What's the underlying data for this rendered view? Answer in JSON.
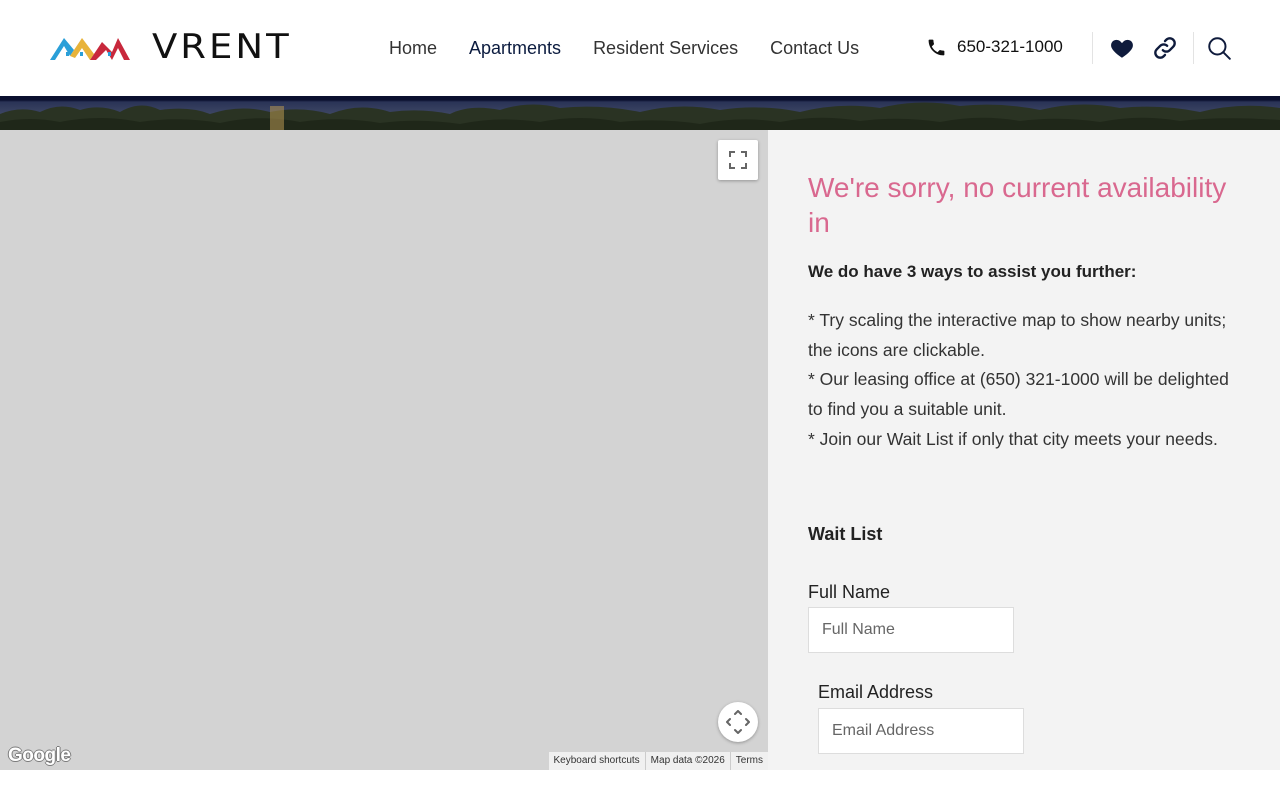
{
  "brand": {
    "name": "VRENT",
    "colors": {
      "blue": "#2a9fd8",
      "gold": "#e8b33a",
      "red": "#c8283c"
    }
  },
  "nav": {
    "items": [
      {
        "label": "Home"
      },
      {
        "label": "Apartments"
      },
      {
        "label": "Resident Services"
      },
      {
        "label": "Contact Us"
      }
    ],
    "active": "Apartments"
  },
  "header": {
    "phone": "650-321-1000",
    "icons": [
      "phone-icon",
      "heart-icon",
      "link-icon",
      "search-icon"
    ]
  },
  "map": {
    "logo": "Google",
    "attribution": {
      "shortcuts": "Keyboard shortcuts",
      "data": "Map data ©2026",
      "terms": "Terms"
    },
    "controls": [
      "fullscreen-icon",
      "pan-icon"
    ]
  },
  "panel": {
    "heading": "We're sorry, no current availability in",
    "heading_color": "#d9688f",
    "subheading": "We do have 3 ways to assist you further:",
    "ways": [
      "*  Try scaling the interactive map to show nearby units; the icons are clickable.",
      "*  Our leasing office at (650) 321-1000 will be delighted to find you a suitable unit.",
      "*  Join our Wait List if only that city meets your needs."
    ],
    "waitlist": {
      "title": "Wait List",
      "full_name": {
        "label": "Full Name",
        "placeholder": "Full Name",
        "value": ""
      },
      "email": {
        "label": "Email Address",
        "placeholder": "Email Address",
        "value": ""
      }
    }
  }
}
